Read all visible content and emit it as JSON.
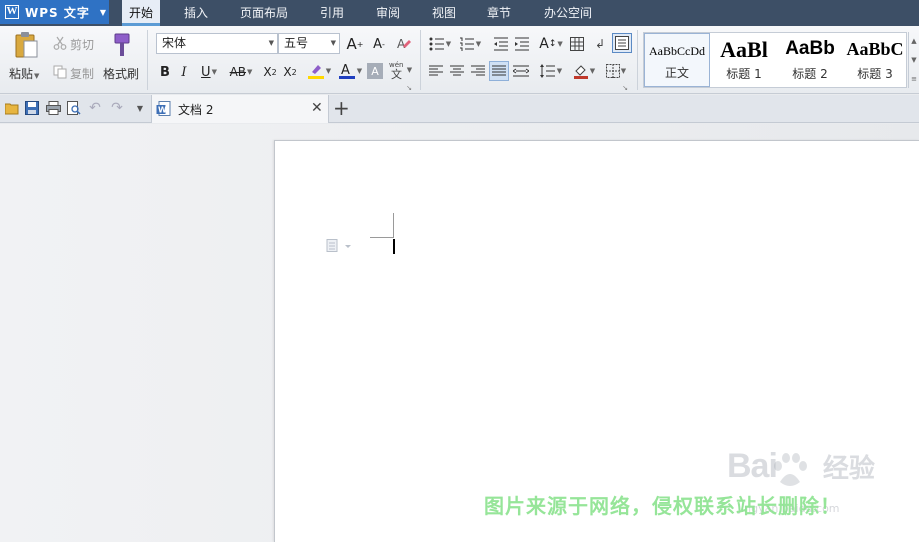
{
  "app": {
    "name": "WPS 文字"
  },
  "menu": {
    "tabs": [
      {
        "label": "开始"
      },
      {
        "label": "插入"
      },
      {
        "label": "页面布局"
      },
      {
        "label": "引用"
      },
      {
        "label": "审阅"
      },
      {
        "label": "视图"
      },
      {
        "label": "章节"
      },
      {
        "label": "办公空间"
      }
    ],
    "active": "开始"
  },
  "ribbon": {
    "clipboard": {
      "paste": "粘贴",
      "cut": "剪切",
      "copy": "复制",
      "format_painter": "格式刷"
    },
    "font": {
      "family": "宋体",
      "size": "五号"
    },
    "styles": [
      {
        "sample": "AaBbCcDd",
        "name": "正文"
      },
      {
        "sample": "AaBl",
        "name": "标题 1"
      },
      {
        "sample": "AaBb",
        "name": "标题 2"
      },
      {
        "sample": "AaBbC",
        "name": "标题 3"
      }
    ]
  },
  "tabbar": {
    "document_title": "文档 2"
  },
  "watermark": {
    "notice": "图片来源于网络，侵权联系站长删除！",
    "brand": "Bai",
    "brand_suffix": "经验",
    "url": "jingyan.baidu.com"
  },
  "colors": {
    "menubar": "#3d4f66",
    "app_button": "#2f72c4",
    "font_color_underline": "#1f3fbf",
    "highlight_underline": "#ffd800",
    "notice_text": "#8be38f"
  }
}
